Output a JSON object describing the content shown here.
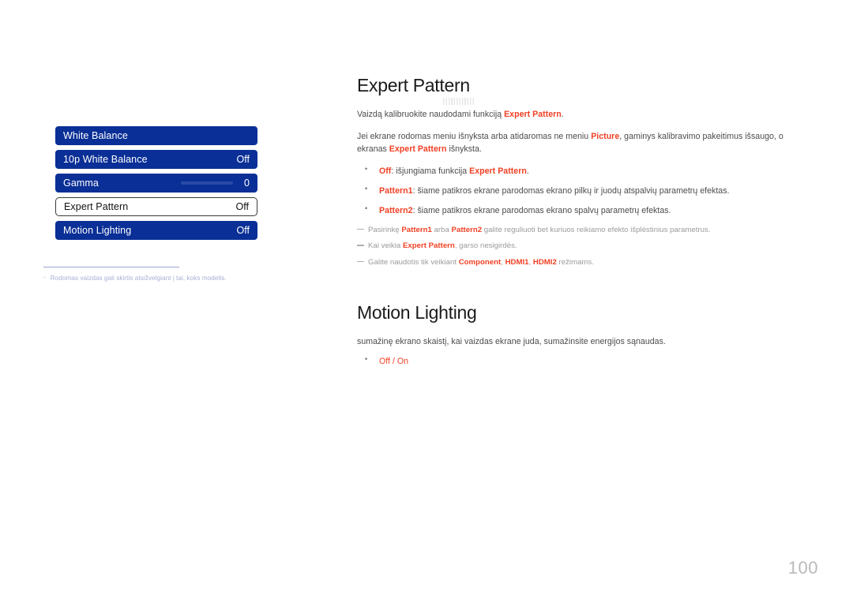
{
  "osd_menu": {
    "name": "picture-expert-settings-menu",
    "rows": [
      {
        "label": "White Balance",
        "value": "",
        "state": "normal",
        "has_slider": false
      },
      {
        "label": "10p White Balance",
        "value": "Off",
        "state": "normal",
        "has_slider": false
      },
      {
        "label": "Gamma",
        "value": "0",
        "state": "normal",
        "has_slider": true
      },
      {
        "label": "Expert Pattern",
        "value": "Off",
        "state": "selected",
        "has_slider": false
      },
      {
        "label": "Motion Lighting",
        "value": "Off",
        "state": "normal",
        "has_slider": false
      }
    ],
    "footnote": {
      "dash": "-",
      "text": "Rodomas vaizdas gali skirtis atsižvelgiant į tai, koks modelis."
    }
  },
  "document": {
    "section1": {
      "title": "Expert Pattern",
      "intro_1": "Vaizdą kalibruokite naudodami funkciją ",
      "intro_1_hl": "Expert Pattern",
      "intro_1_end": ".",
      "intro_2_a": "Jei ekrane rodomas meniu išnyksta arba atidaromas ne meniu ",
      "intro_2_hl1": "Picture",
      "intro_2_b": ", gaminys kalibravimo pakeitimus išsaugo, o ekranas ",
      "intro_2_hl2": "Expert Pattern",
      "intro_2_c": " išnyksta.",
      "bullets": [
        {
          "term": "Off",
          "rest": ": išjungiama funkcija ",
          "term2": "Expert Pattern",
          "rest2": "."
        },
        {
          "term": "Pattern1",
          "rest": ": šiame patikros ekrane parodomas ekrano pilkų ir juodų atspalvių parametrų efektas.",
          "term2": "",
          "rest2": ""
        },
        {
          "term": "Pattern2",
          "rest": ": šiame patikros ekrane parodomas ekrano spalvų parametrų efektas.",
          "term2": "",
          "rest2": ""
        }
      ],
      "notes": [
        {
          "a": "Pasirinkę ",
          "h1": "Pattern1",
          "b": " arba ",
          "h2": "Pattern2",
          "c": " galite reguliuoti bet kuriuos reikiamo efekto išplėstinius parametrus.",
          "h3": "",
          "d": ""
        },
        {
          "a": "Kai veikia ",
          "h1": "Expert Pattern",
          "b": ", garso nesigirdės.",
          "h2": "",
          "c": "",
          "h3": "",
          "d": ""
        },
        {
          "a": "Galite naudotis tik veikiant ",
          "h1": "Component",
          "b": ", ",
          "h2": "HDMI1",
          "c": ", ",
          "h3": "HDMI2",
          "d": " režimams."
        }
      ]
    },
    "section2": {
      "title": "Motion Lighting",
      "desc": "sumažinę ekrano skaistį, kai vaizdas ekrane juda, sumažinsite energijos sąnaudas.",
      "bullet_options": "Off / On"
    }
  },
  "page_number": "100",
  "colors": {
    "osd_blue": "#0a2f96",
    "highlight_red": "#ef3f23",
    "body_gray": "#4b4b4b",
    "note_gray": "#9b9b9b",
    "footnote_blue_gray": "#a7b0d4",
    "page_number_gray": "#b9b9b9"
  }
}
